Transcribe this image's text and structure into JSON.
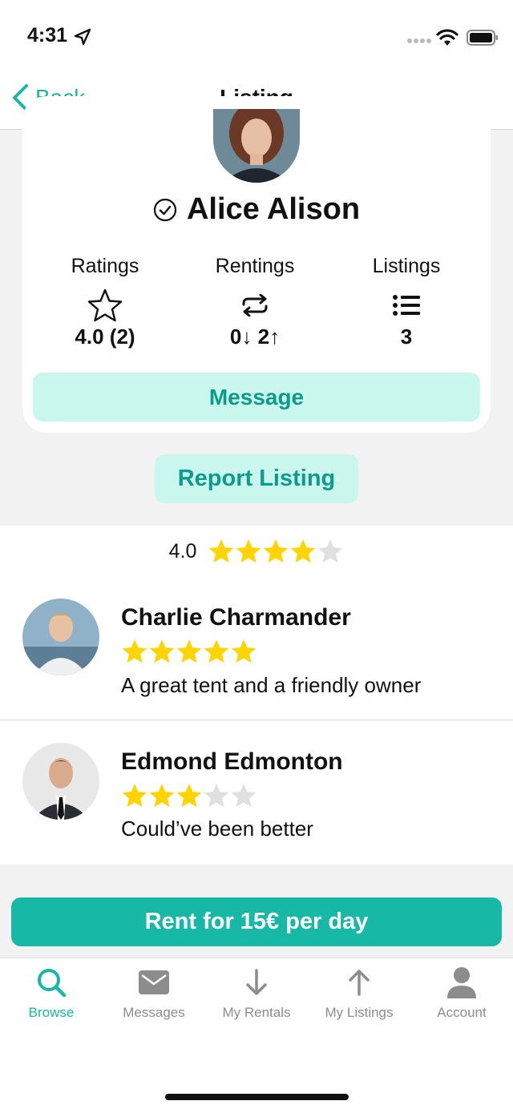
{
  "status_bar": {
    "time": "4:31"
  },
  "nav": {
    "back_label": "Back",
    "title": "Listing"
  },
  "profile": {
    "name": "Alice Alison",
    "stats": [
      {
        "label": "Ratings",
        "icon": "star-outline-icon",
        "value": "4.0 (2)"
      },
      {
        "label": "Rentings",
        "icon": "repeat-icon",
        "value": "0↓ 2↑"
      },
      {
        "label": "Listings",
        "icon": "list-icon",
        "value": "3"
      }
    ],
    "message_label": "Message"
  },
  "report_label": "Report Listing",
  "reviews": {
    "average": "4.0",
    "average_stars": 4,
    "items": [
      {
        "name": "Charlie Charmander",
        "stars": 5,
        "text": "A great tent and a friendly owner"
      },
      {
        "name": "Edmond Edmonton",
        "stars": 3,
        "text": "Could’ve been better"
      }
    ]
  },
  "rent_label": "Rent for 15€ per day",
  "tabs": [
    {
      "label": "Browse",
      "active": true
    },
    {
      "label": "Messages",
      "active": false
    },
    {
      "label": "My Rentals",
      "active": false
    },
    {
      "label": "My Listings",
      "active": false
    },
    {
      "label": "Account",
      "active": false
    }
  ],
  "colors": {
    "accent": "#17b8a6",
    "accent_light": "#c9f7ee",
    "star": "#ffd400",
    "star_empty": "#e0e0e0"
  }
}
